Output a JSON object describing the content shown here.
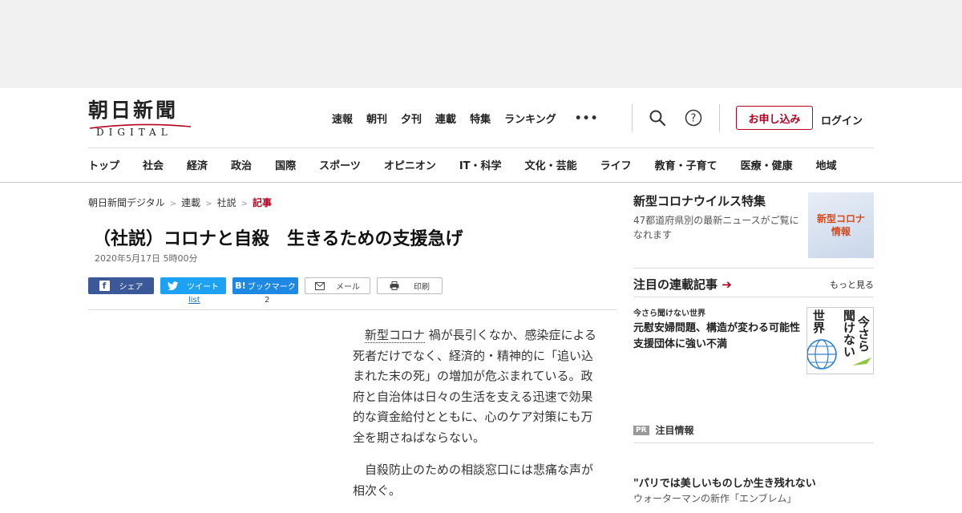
{
  "site": {
    "logo_main": "朝日新聞",
    "logo_sub": "DIGITAL"
  },
  "topnav": {
    "items": [
      "速報",
      "朝刊",
      "夕刊",
      "連載",
      "特集",
      "ランキング"
    ],
    "more_glyph": "•••"
  },
  "header": {
    "apply_label": "お申し込み",
    "login_label": "ログイン"
  },
  "catnav": {
    "items": [
      "トップ",
      "社会",
      "経済",
      "政治",
      "国際",
      "スポーツ",
      "オピニオン",
      "IT・科学",
      "文化・芸能",
      "ライフ",
      "教育・子育て",
      "医療・健康",
      "地域"
    ]
  },
  "breadcrumb": {
    "items": [
      "朝日新聞デジタル",
      "連載",
      "社説"
    ],
    "current": "記事",
    "separator": ">"
  },
  "article": {
    "headline": "（社説）コロナと自殺　生きるための支援急げ",
    "date": "2020年5月17日 5時00分",
    "link_text": "新型コロナ",
    "p1_rest": "禍が長引くなか、感染症による死者だけでなく、経済的・精神的に「追い込まれた末の死」の増加が危ぶまれている。政府と自治体は日々の生活を支える迅速で効果的な資金給付とともに、心のケア対策にも万全を期さねばならない。",
    "p2": "自殺防止のための相談窓口には悲痛な声が相次ぐ。"
  },
  "share": {
    "facebook": "シェア",
    "twitter": "ツイート",
    "hatena": "ブックマーク",
    "hatena_icon": "B!",
    "mail": "メール",
    "print": "印刷",
    "twitter_count": "list",
    "hatena_count": "2"
  },
  "sidebar": {
    "corona": {
      "title": "新型コロナウイルス特集",
      "desc": "47都道府県別の最新ニュースがご覧になれます",
      "badge_line1": "新型コロナ",
      "badge_line2": "情報"
    },
    "series": {
      "title": "注目の連載記事",
      "arrow": "➔",
      "more": "もっと見る",
      "kicker": "今さら聞けない世界",
      "headline": "元慰安婦問題、構造が変わる可能性　支援団体に強い不満",
      "img_text_1": "今さら",
      "img_text_2": "聞けない",
      "img_text_3": "世界"
    },
    "pr": {
      "badge": "PR",
      "label": "注目情報"
    },
    "ad": {
      "headline": "\"パリでは美しいものしか生き残れない",
      "sub": "ウォーターマンの新作「エンブレム」"
    }
  },
  "colors": {
    "accent": "#b4001e",
    "facebook": "#3b5998",
    "twitter": "#1da1f2",
    "hatena": "#1e88e5"
  }
}
